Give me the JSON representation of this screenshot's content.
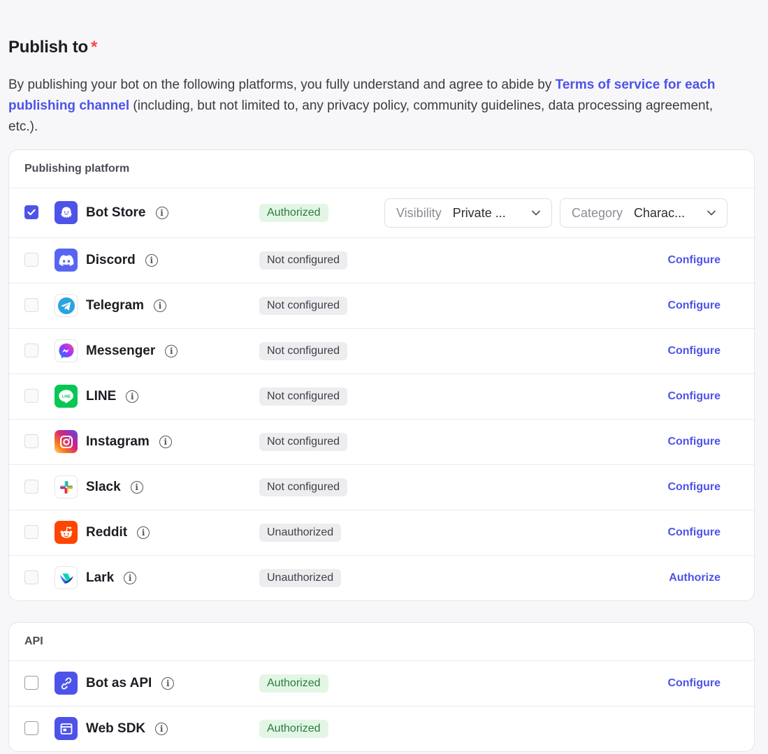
{
  "header": {
    "title": "Publish to",
    "required_mark": "*",
    "desc_prefix": "By publishing your bot on the following platforms, you fully understand and agree to abide by ",
    "desc_link": "Terms of service for each publishing channel",
    "desc_suffix": " (including, but not limited to, any privacy policy, community guidelines, data processing agreement, etc.)."
  },
  "platforms": {
    "section_title": "Publishing platform",
    "rows": [
      {
        "name": "Bot Store",
        "status": "Authorized",
        "checked": true,
        "icon": "bot-store-icon"
      },
      {
        "name": "Discord",
        "status": "Not configured",
        "action": "Configure",
        "icon": "discord-icon"
      },
      {
        "name": "Telegram",
        "status": "Not configured",
        "action": "Configure",
        "icon": "telegram-icon"
      },
      {
        "name": "Messenger",
        "status": "Not configured",
        "action": "Configure",
        "icon": "messenger-icon"
      },
      {
        "name": "LINE",
        "status": "Not configured",
        "action": "Configure",
        "icon": "line-icon"
      },
      {
        "name": "Instagram",
        "status": "Not configured",
        "action": "Configure",
        "icon": "instagram-icon"
      },
      {
        "name": "Slack",
        "status": "Not configured",
        "action": "Configure",
        "icon": "slack-icon"
      },
      {
        "name": "Reddit",
        "status": "Unauthorized",
        "action": "Configure",
        "icon": "reddit-icon"
      },
      {
        "name": "Lark",
        "status": "Unauthorized",
        "action": "Authorize",
        "icon": "lark-icon"
      }
    ],
    "visibility": {
      "label": "Visibility",
      "value": "Private ..."
    },
    "category": {
      "label": "Category",
      "value": "Charac..."
    }
  },
  "api": {
    "section_title": "API",
    "rows": [
      {
        "name": "Bot as API",
        "status": "Authorized",
        "action": "Configure",
        "icon": "api-link-icon"
      },
      {
        "name": "Web SDK",
        "status": "Authorized",
        "icon": "web-sdk-icon"
      }
    ]
  },
  "colors": {
    "accent": "#4d53e8",
    "authorized_bg": "#e3f6e6",
    "authorized_text": "#2a7b3c",
    "neutral_badge_bg": "#ededf0"
  }
}
